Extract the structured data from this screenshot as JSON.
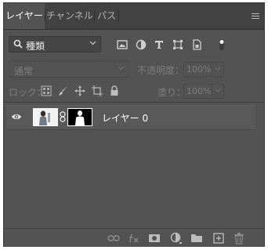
{
  "tabs": [
    {
      "label": "レイヤー",
      "active": true
    },
    {
      "label": "チャンネル",
      "active": false
    },
    {
      "label": "パス",
      "active": false
    }
  ],
  "filter": {
    "kind_label": "種類",
    "icons": [
      "image-filter-icon",
      "adjustment-filter-icon",
      "type-filter-icon",
      "shape-filter-icon",
      "smart-object-filter-icon",
      "filter-toggle-icon"
    ]
  },
  "blend": {
    "mode": "通常",
    "opacity_label": "不透明度：",
    "opacity_value": "100%"
  },
  "lock": {
    "label": "ロック：",
    "fill_label": "塗り：",
    "fill_value": "100%"
  },
  "layers": [
    {
      "name": "レイヤー 0",
      "visible": true,
      "has_mask": true
    }
  ],
  "colors": {
    "panel_bg": "#535353",
    "tab_bar_bg": "#424242",
    "selected_row": "#595959"
  }
}
